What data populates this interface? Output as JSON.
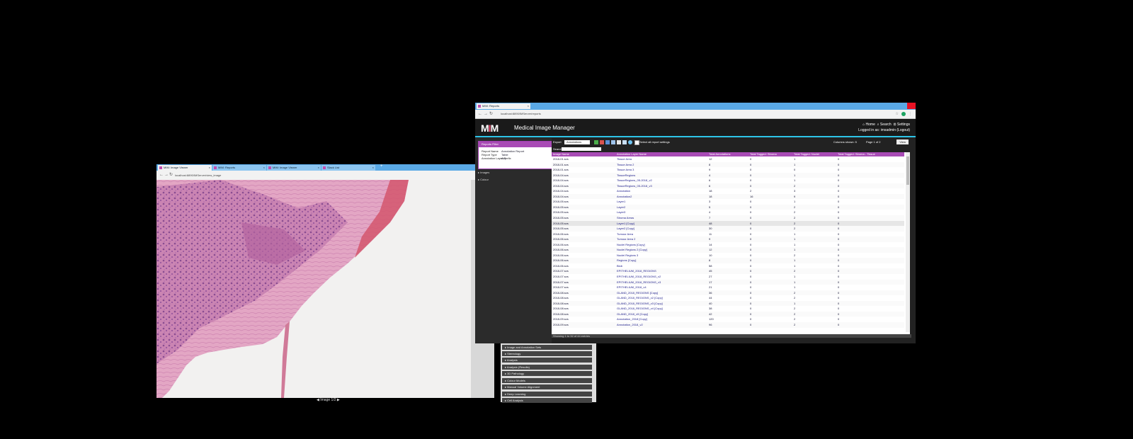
{
  "left_window": {
    "tabs": [
      {
        "label": "MIM: Image Viewer",
        "active": true
      },
      {
        "label": "MIM: Reports",
        "active": false
      },
      {
        "label": "MIM: Image Viewer",
        "active": false
      },
      {
        "label": "Slack List",
        "active": false
      }
    ],
    "url": "localhost:8890/IMServer/view_image"
  },
  "footer_caption": "Image 1/2",
  "mid_panel": {
    "items": [
      "Image and Annotation Sets",
      "Stereology",
      "Analysis",
      "Analysis (Results)",
      "3D Pathology",
      "Colour Models",
      "Manual Volume Alignment",
      "Deep Learning",
      "Cell Analysis"
    ]
  },
  "right_window": {
    "tab": "MIM: Reports",
    "url": "localhost:8890/IMServer/reports",
    "app": {
      "logo_left": "M",
      "logo_mid": "I",
      "logo_right": "M",
      "title": "Medical Image Manager",
      "nav": {
        "home": "Home",
        "search": "Search",
        "settings": "Settings"
      },
      "logged_in": "Logged in as: imsadmin (Logout)"
    },
    "sidebar": {
      "panel_title": "Reports Filter",
      "rows": [
        {
          "label": "Report Name",
          "value": "Annotation Report"
        },
        {
          "label": "Report Type",
          "value": "Table"
        },
        {
          "label": "Annotation Layer Prefix",
          "value": "Any"
        }
      ],
      "links": [
        "Images",
        "Colour"
      ]
    },
    "toolbar": {
      "export_label": "Export",
      "report_name": "Annotations",
      "select_label": "Select all report settings",
      "right_text": "Columns shown: 5",
      "page_label": "Page 1 of 2",
      "view_button": "View"
    },
    "search_label": "Search",
    "table": {
      "headers": [
        "Image Name",
        "Annotation Layer Name",
        "Total Annotations",
        "Total Tagged: Stroma",
        "Total Tagged: Nuclei",
        "Total Tagged: Stroma - Tissue"
      ],
      "rows": [
        [
          "2018-01.svs",
          "Tissue Area",
          "12",
          "0",
          "1",
          "0"
        ],
        [
          "2018-01.svs",
          "Tissue Area 2",
          "8",
          "0",
          "1",
          "0"
        ],
        [
          "2018-01.svs",
          "Tissue Area 3",
          "9",
          "0",
          "0",
          "0"
        ],
        [
          "2018-04.svs",
          "TissueRegions",
          "4",
          "0",
          "1",
          "0"
        ],
        [
          "2018-04.svs",
          "TissueRegions_05-2018_v2",
          "6",
          "0",
          "1",
          "0"
        ],
        [
          "2018-04.svs",
          "TissueRegions_05-2018_v3",
          "6",
          "0",
          "2",
          "0"
        ],
        [
          "2018-04.svs",
          "Annotation",
          "18",
          "2",
          "3",
          "0"
        ],
        [
          "2018-04.svs",
          "Annotation2",
          "18",
          "16",
          "9",
          "0"
        ],
        [
          "2018-05.svs",
          "Layer1",
          "3",
          "0",
          "1",
          "0"
        ],
        [
          "2018-05.svs",
          "Layer2",
          "5",
          "0",
          "2",
          "0"
        ],
        [
          "2018-05.svs",
          "Layer3",
          "4",
          "0",
          "2",
          "0"
        ],
        [
          "2018-05.svs",
          "Stroma Areas",
          "7",
          "0",
          "2",
          "0"
        ],
        [
          "2018-05.svs",
          "Layer1 [Copy]",
          "48",
          "0",
          "2",
          "0"
        ],
        [
          "2018-05.svs",
          "Layer2 [Copy]",
          "30",
          "0",
          "2",
          "0"
        ],
        [
          "2018-06.svs",
          "Tumour Area",
          "11",
          "0",
          "1",
          "0"
        ],
        [
          "2018-06.svs",
          "Tumour Area 2",
          "9",
          "0",
          "1",
          "0"
        ],
        [
          "2018-06.svs",
          "Nuclei Regions [Copy]",
          "14",
          "0",
          "1",
          "0"
        ],
        [
          "2018-06.svs",
          "Nuclei Regions 2 [Copy]",
          "12",
          "0",
          "1",
          "0"
        ],
        [
          "2018-06.svs",
          "Nuclei Regions 3",
          "10",
          "0",
          "2",
          "0"
        ],
        [
          "2018-06.svs",
          "Regions [Copy]",
          "8",
          "0",
          "1",
          "0"
        ],
        [
          "2018-06.svs",
          "Blob",
          "58",
          "0",
          "1",
          "0"
        ],
        [
          "2018-07.svs",
          "EPITHELIUM_2018_REGIONS",
          "45",
          "0",
          "2",
          "0"
        ],
        [
          "2018-07.svs",
          "EPITHELIUM_2018_REGIONS_v2",
          "27",
          "0",
          "1",
          "0"
        ],
        [
          "2018-07.svs",
          "EPITHELIUM_2018_REGIONS_v3",
          "17",
          "0",
          "1",
          "0"
        ],
        [
          "2018-07.svs",
          "EPITHELIUM_2018_v4",
          "21",
          "0",
          "1",
          "0"
        ],
        [
          "2018-08.svs",
          "GLAND_2018_REGIONS [Copy]",
          "36",
          "0",
          "2",
          "0"
        ],
        [
          "2018-08.svs",
          "GLAND_2018_REGIONS_v2 [Copy]",
          "44",
          "0",
          "2",
          "0"
        ],
        [
          "2018-08.svs",
          "GLAND_2018_REGIONS_v3 [Copy]",
          "40",
          "0",
          "1",
          "0"
        ],
        [
          "2018-08.svs",
          "GLAND_2018_REGIONS_v4 [Copy]",
          "38",
          "0",
          "2",
          "0"
        ],
        [
          "2018-08.svs",
          "GLAND_2018_v5 [Copy]",
          "42",
          "0",
          "2",
          "0"
        ],
        [
          "2018-09.svs",
          "Annotation_2018 [Copy]",
          "120",
          "0",
          "2",
          "0"
        ],
        [
          "2018-09.svs",
          "Annotation_2018_v2",
          "96",
          "0",
          "2",
          "0"
        ]
      ]
    },
    "status_text": "Showing 1 to 32 of 44 entries"
  }
}
